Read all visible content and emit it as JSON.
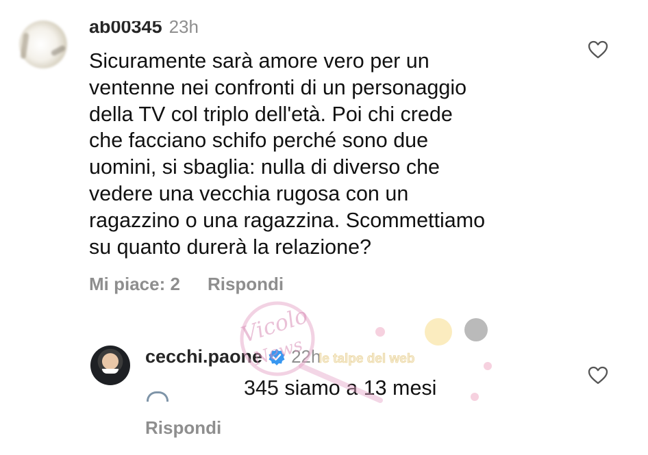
{
  "comment": {
    "username": "ab00345",
    "time": "23h",
    "text": "Sicuramente sarà amore vero per un\nventenne nei confronti di un personaggio\ndella TV col triplo dell'età. Poi chi crede\nche facciano schifo perché sono due\nuomini, si sbaglia: nulla di diverso che\nvedere una vecchia rugosa con un\nragazzino o una ragazzina. Scommettiamo\nsu quanto durerà la relazione?",
    "likes_label": "Mi piace: 2",
    "reply_label": "Rispondi"
  },
  "reply": {
    "username": "cecchi.paone",
    "time": "22h",
    "mention_visible": "345",
    "text": " siamo a 13 mesi",
    "reply_label": "Rispondi"
  },
  "watermark": {
    "line1": "Vicolo",
    "line2": "News",
    "line3": "le talpe del web"
  },
  "icons": {
    "like": "heart-outline-icon",
    "verified": "verified-badge-icon"
  },
  "colors": {
    "meta_gray": "#8e8e8e",
    "text": "#111111",
    "verified_blue": "#3897f0",
    "watermark_pink": "#d98fb8"
  }
}
